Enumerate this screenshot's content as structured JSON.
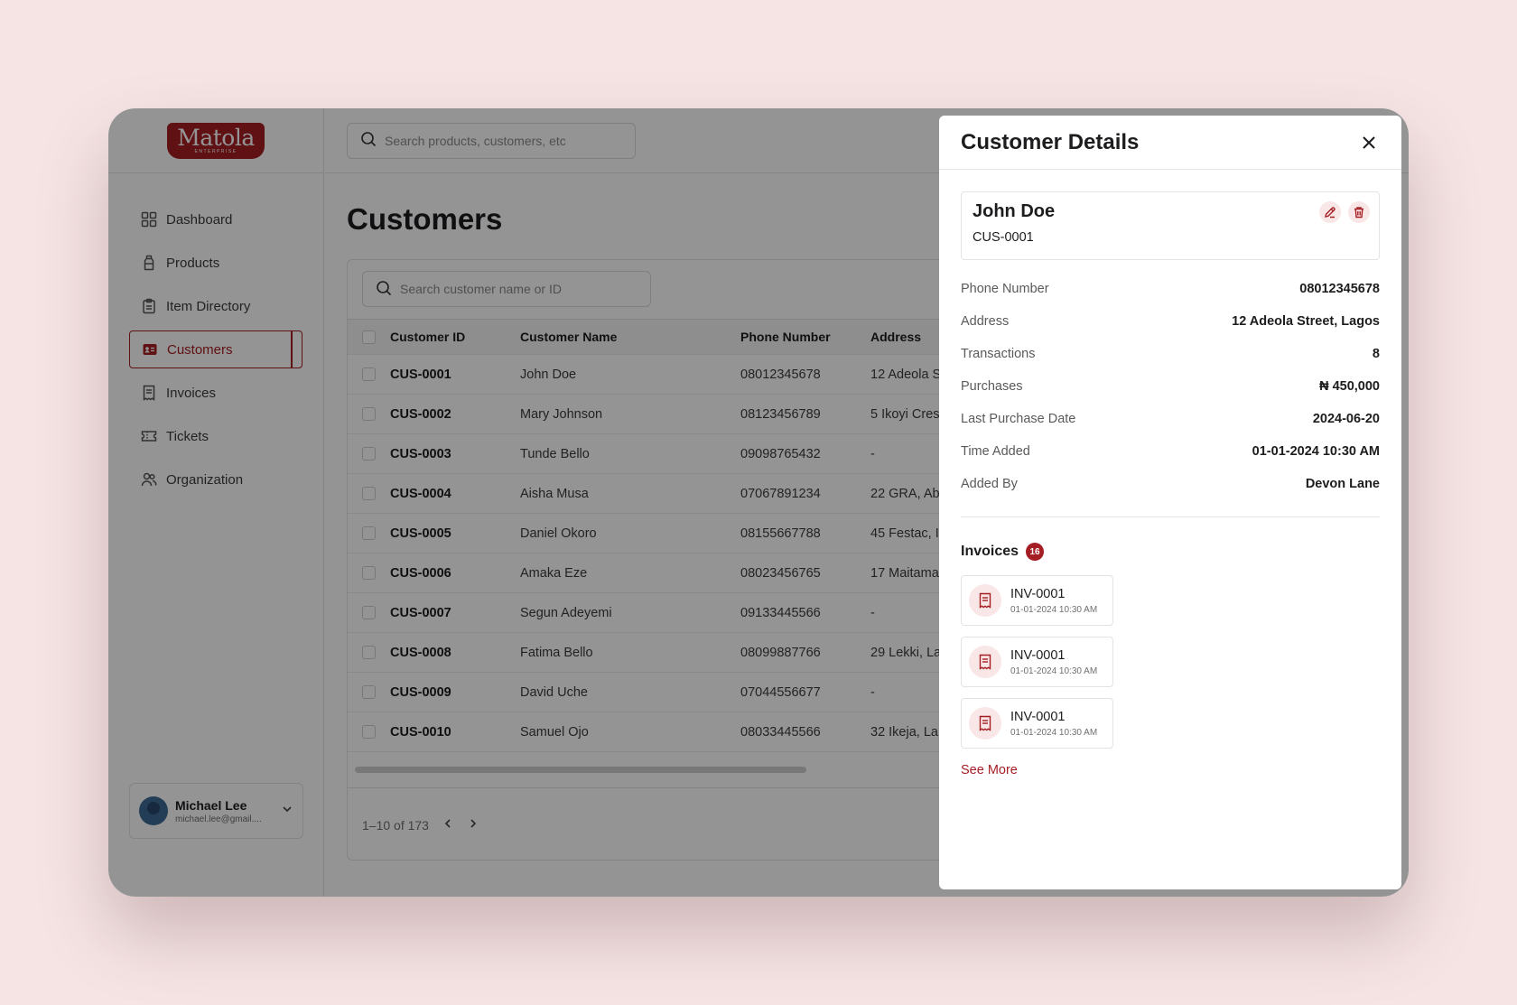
{
  "brand": {
    "logo_text": "Matola",
    "logo_sub": "ENTERPRISE",
    "accent": "#a51e24"
  },
  "topbar": {
    "search_placeholder": "Search products, customers, etc"
  },
  "sidebar": {
    "items": [
      {
        "label": "Dashboard",
        "icon": "grid-icon"
      },
      {
        "label": "Products",
        "icon": "bottle-icon"
      },
      {
        "label": "Item Directory",
        "icon": "clipboard-icon"
      },
      {
        "label": "Customers",
        "icon": "id-card-icon",
        "active": true
      },
      {
        "label": "Invoices",
        "icon": "receipt-icon"
      },
      {
        "label": "Tickets",
        "icon": "ticket-icon"
      },
      {
        "label": "Organization",
        "icon": "users-icon"
      }
    ],
    "user": {
      "name": "Michael Lee",
      "email": "michael.lee@gmail...."
    }
  },
  "page": {
    "title": "Customers",
    "table_search_placeholder": "Search customer name or ID"
  },
  "table": {
    "columns": [
      "Customer ID",
      "Customer Name",
      "Phone Number",
      "Address"
    ],
    "rows": [
      {
        "id": "CUS-0001",
        "name": "John Doe",
        "phone": "08012345678",
        "address": "12 Adeola S"
      },
      {
        "id": "CUS-0002",
        "name": "Mary Johnson",
        "phone": "08123456789",
        "address": "5 Ikoyi Cres"
      },
      {
        "id": "CUS-0003",
        "name": "Tunde Bello",
        "phone": "09098765432",
        "address": "-"
      },
      {
        "id": "CUS-0004",
        "name": "Aisha Musa",
        "phone": "07067891234",
        "address": "22 GRA, Ab"
      },
      {
        "id": "CUS-0005",
        "name": "Daniel Okoro",
        "phone": "08155667788",
        "address": "45 Festac, I"
      },
      {
        "id": "CUS-0006",
        "name": "Amaka Eze",
        "phone": "08023456765",
        "address": "17 Maitama"
      },
      {
        "id": "CUS-0007",
        "name": "Segun Adeyemi",
        "phone": "09133445566",
        "address": "-"
      },
      {
        "id": "CUS-0008",
        "name": "Fatima Bello",
        "phone": "08099887766",
        "address": "29 Lekki, La"
      },
      {
        "id": "CUS-0009",
        "name": "David Uche",
        "phone": "07044556677",
        "address": "-"
      },
      {
        "id": "CUS-0010",
        "name": "Samuel Ojo",
        "phone": "08033445566",
        "address": "32 Ikeja, La"
      }
    ],
    "pagination": "1–10 of 173"
  },
  "drawer": {
    "title": "Customer Details",
    "customer": {
      "name": "John Doe",
      "id": "CUS-0001"
    },
    "details": [
      {
        "label": "Phone Number",
        "value": "08012345678"
      },
      {
        "label": "Address",
        "value": "12 Adeola Street, Lagos"
      },
      {
        "label": "Transactions",
        "value": "8"
      },
      {
        "label": "Purchases",
        "value": "₦ 450,000"
      },
      {
        "label": "Last Purchase Date",
        "value": "2024-06-20"
      },
      {
        "label": "Time Added",
        "value": "01-01-2024 10:30 AM"
      },
      {
        "label": "Added By",
        "value": "Devon Lane"
      }
    ],
    "invoices_heading": "Invoices",
    "invoices_count": "16",
    "invoices": [
      {
        "number": "INV-0001",
        "date": "01-01-2024 10:30 AM"
      },
      {
        "number": "INV-0001",
        "date": "01-01-2024 10:30 AM"
      },
      {
        "number": "INV-0001",
        "date": "01-01-2024 10:30 AM"
      }
    ],
    "see_more": "See More"
  }
}
